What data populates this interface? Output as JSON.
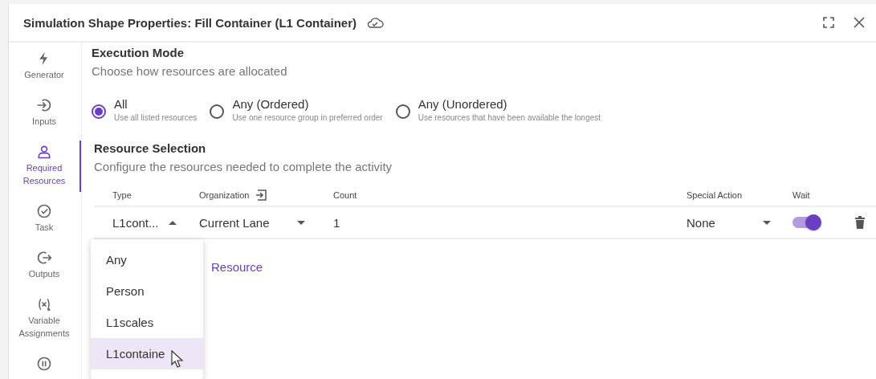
{
  "window": {
    "title": "Simulation Shape Properties: Fill Container (L1 Container)"
  },
  "sidebar": {
    "items": [
      {
        "label": "Generator",
        "selected": false
      },
      {
        "label": "Inputs",
        "selected": false
      },
      {
        "label": "Required Resources",
        "selected": true
      },
      {
        "label": "Task",
        "selected": false
      },
      {
        "label": "Outputs",
        "selected": false
      },
      {
        "label": "Variable Assignments",
        "selected": false
      },
      {
        "selected": false
      }
    ]
  },
  "execution_mode": {
    "title": "Execution Mode",
    "subtitle": "Choose how resources are allocated",
    "options": [
      {
        "label": "All",
        "description": "Use all listed resources",
        "selected": true
      },
      {
        "label": "Any (Ordered)",
        "description": "Use one resource group in preferred order",
        "selected": false
      },
      {
        "label": "Any (Unordered)",
        "description": "Use resources that have been available the longest",
        "selected": false
      }
    ]
  },
  "resource_selection": {
    "title": "Resource Selection",
    "subtitle": "Configure the resources needed to complete the activity",
    "columns": [
      "Type",
      "Organization",
      "Count",
      "Special Action",
      "Wait"
    ],
    "rows": [
      {
        "type": "L1cont...",
        "type_expanded": true,
        "organization": "Current Lane",
        "count": "1",
        "special_action": "None",
        "wait": true
      }
    ],
    "add_link": "Resource"
  },
  "type_menu": {
    "items": [
      {
        "label": "Any",
        "selected": false
      },
      {
        "label": "Person",
        "selected": false
      },
      {
        "label": "L1scales",
        "selected": false
      },
      {
        "label": "L1containe",
        "selected": true
      }
    ]
  }
}
